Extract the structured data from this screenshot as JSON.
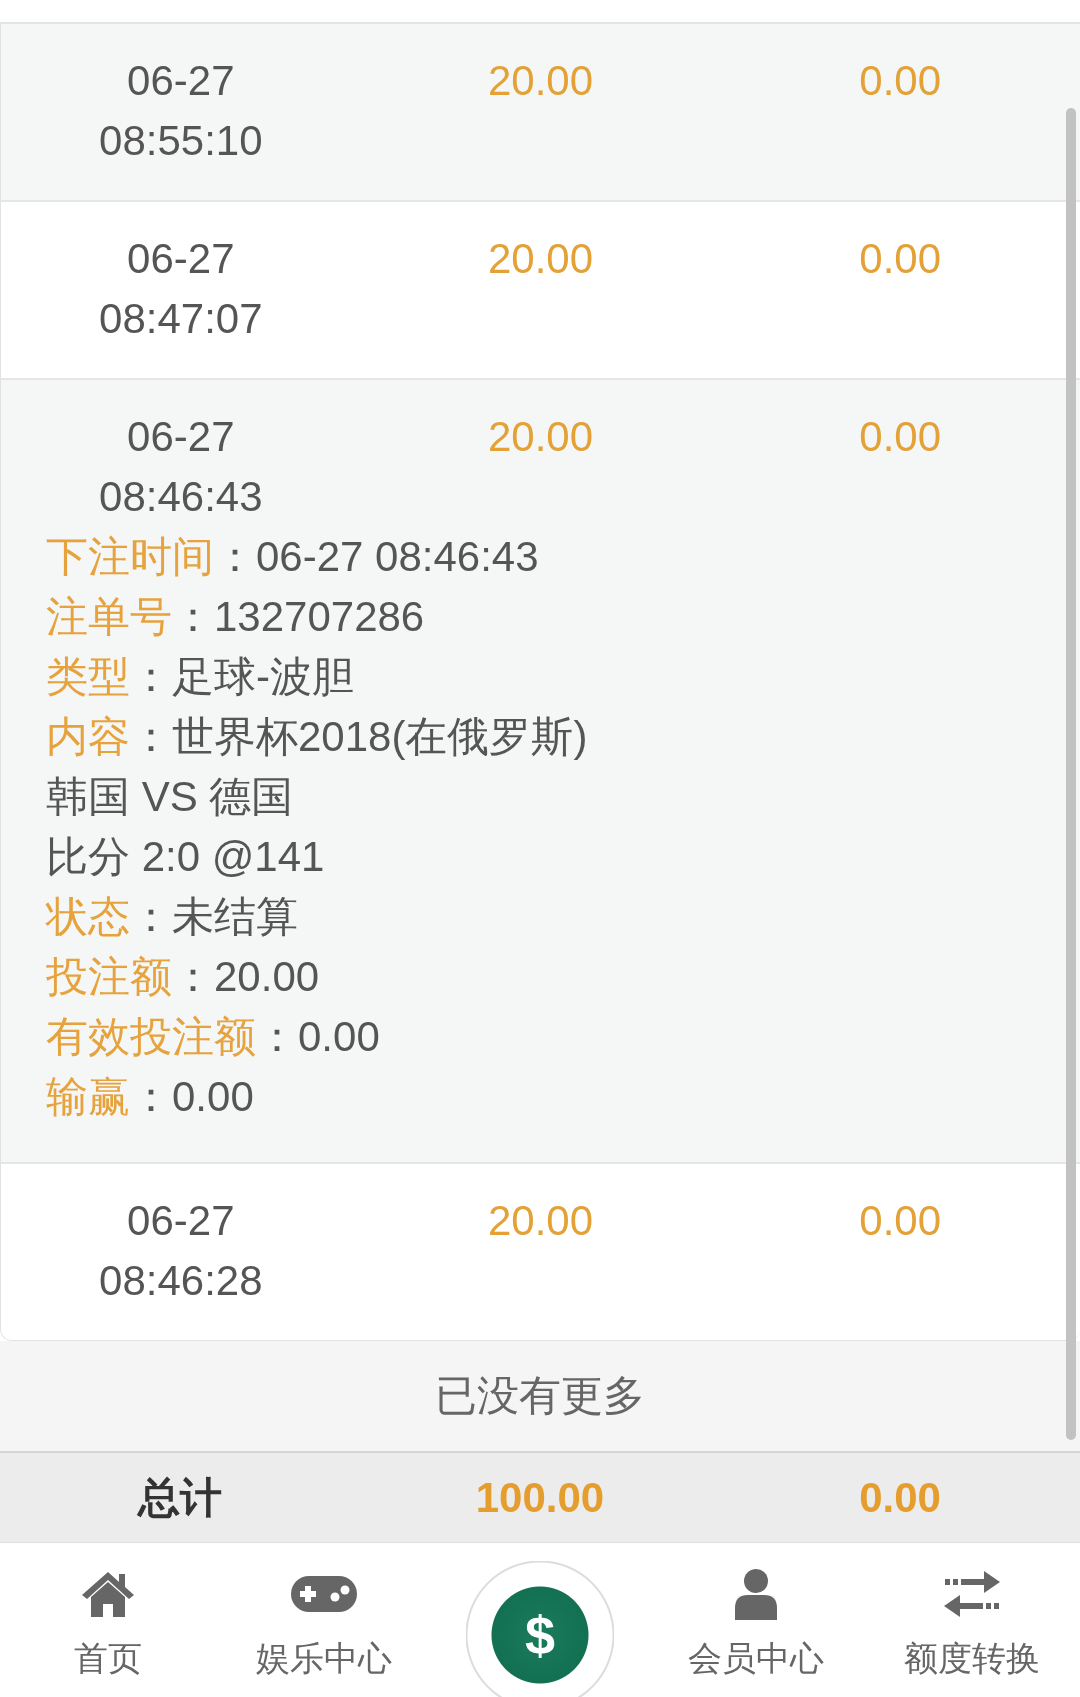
{
  "rows": [
    {
      "column_1": [
        "06-27",
        "08:55:10"
      ],
      "column_2": "20.00",
      "column_3": "0.00"
    },
    {
      "column_1": [
        "06-27",
        "08:47:07"
      ],
      "column_2": "20.00",
      "column_3": "0.00"
    },
    {
      "column_1": [
        "06-27",
        "08:46:43"
      ],
      "column_2": "20.00",
      "column_3": "0.00",
      "details": [
        {
          "kind": "field",
          "label": "下注时间",
          "separator": "：",
          "value": "06-27 08:46:43"
        },
        {
          "kind": "field",
          "label": "注单号",
          "separator": "：",
          "value": "132707286"
        },
        {
          "kind": "field",
          "label": "类型",
          "separator": "：",
          "value": "足球-波胆"
        },
        {
          "kind": "field",
          "label": "内容",
          "separator": "：",
          "value": "世界杯2018(在俄罗斯)"
        },
        {
          "kind": "text",
          "text": "韩国 VS 德国"
        },
        {
          "kind": "text",
          "text": "比分 2:0 @141"
        },
        {
          "kind": "field",
          "label": "状态",
          "separator": "：",
          "value": "未结算"
        },
        {
          "kind": "field",
          "label": "投注额",
          "separator": "：",
          "value": "20.00"
        },
        {
          "kind": "field",
          "label": "有效投注额",
          "separator": "：",
          "value": "0.00"
        },
        {
          "kind": "field",
          "label": "输赢",
          "separator": "：",
          "value": "0.00"
        }
      ]
    },
    {
      "column_1": [
        "06-27",
        "08:46:28"
      ],
      "column_2": "20.00",
      "column_3": "0.00"
    }
  ],
  "end_note": "已没有更多",
  "total": {
    "label": "总计",
    "column_2": "100.00",
    "column_3": "0.00"
  },
  "bottom_nav": [
    {
      "kind": "tab",
      "label": "首页",
      "selected": false
    },
    {
      "kind": "tab",
      "label": "娱乐中心",
      "selected": false
    },
    {
      "kind": "center",
      "symbol": "$",
      "selected": false
    },
    {
      "kind": "tab",
      "label": "会员中心",
      "selected": false
    },
    {
      "kind": "tab",
      "label": "额度转换",
      "selected": false
    }
  ]
}
